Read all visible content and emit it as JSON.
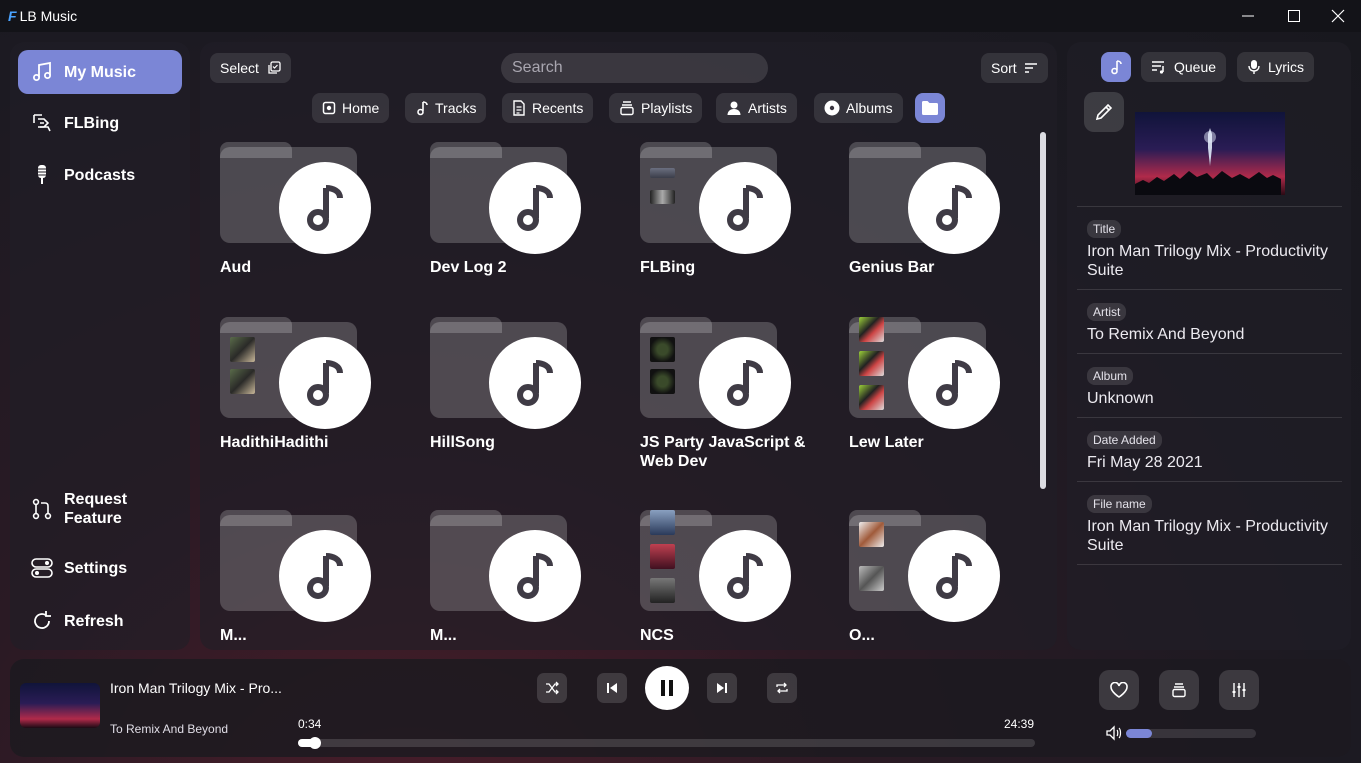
{
  "app": {
    "logo": "F",
    "title": "LB Music"
  },
  "sidebar": {
    "items": [
      {
        "label": "My Music"
      },
      {
        "label": "FLBing"
      },
      {
        "label": "Podcasts"
      }
    ],
    "bottom": [
      {
        "label": "Request Feature"
      },
      {
        "label": "Settings"
      },
      {
        "label": "Refresh"
      }
    ]
  },
  "toolbar": {
    "select_label": "Select",
    "search_placeholder": "Search",
    "sort_label": "Sort"
  },
  "tabs": [
    {
      "label": "Home"
    },
    {
      "label": "Tracks"
    },
    {
      "label": "Recents"
    },
    {
      "label": "Playlists"
    },
    {
      "label": "Artists"
    },
    {
      "label": "Albums"
    }
  ],
  "folders": [
    {
      "name": "Aud"
    },
    {
      "name": "Dev Log 2"
    },
    {
      "name": "FLBing"
    },
    {
      "name": "Genius Bar"
    },
    {
      "name": "HadithiHadithi"
    },
    {
      "name": "HillSong"
    },
    {
      "name": "JS Party JavaScript & Web Dev"
    },
    {
      "name": "Lew Later"
    },
    {
      "name": "M..."
    },
    {
      "name": "M..."
    },
    {
      "name": "NCS"
    },
    {
      "name": "O..."
    }
  ],
  "right_panel": {
    "tabs": {
      "queue": "Queue",
      "lyrics": "Lyrics"
    },
    "fields": [
      {
        "label": "Title",
        "value": "Iron Man Trilogy Mix - Productivity Suite"
      },
      {
        "label": "Artist",
        "value": "To Remix And Beyond"
      },
      {
        "label": "Album",
        "value": "Unknown"
      },
      {
        "label": "Date Added",
        "value": "Fri May 28 2021"
      },
      {
        "label": "File name",
        "value": "Iron Man Trilogy Mix - Productivity Suite"
      }
    ]
  },
  "player": {
    "title": "Iron Man Trilogy Mix - Pro...",
    "artist": "To Remix And Beyond",
    "elapsed": "0:34",
    "duration": "24:39",
    "progress": 0.023,
    "volume": 0.2
  },
  "colors": {
    "accent": "#7b86d6",
    "background": "#1c1a22"
  }
}
